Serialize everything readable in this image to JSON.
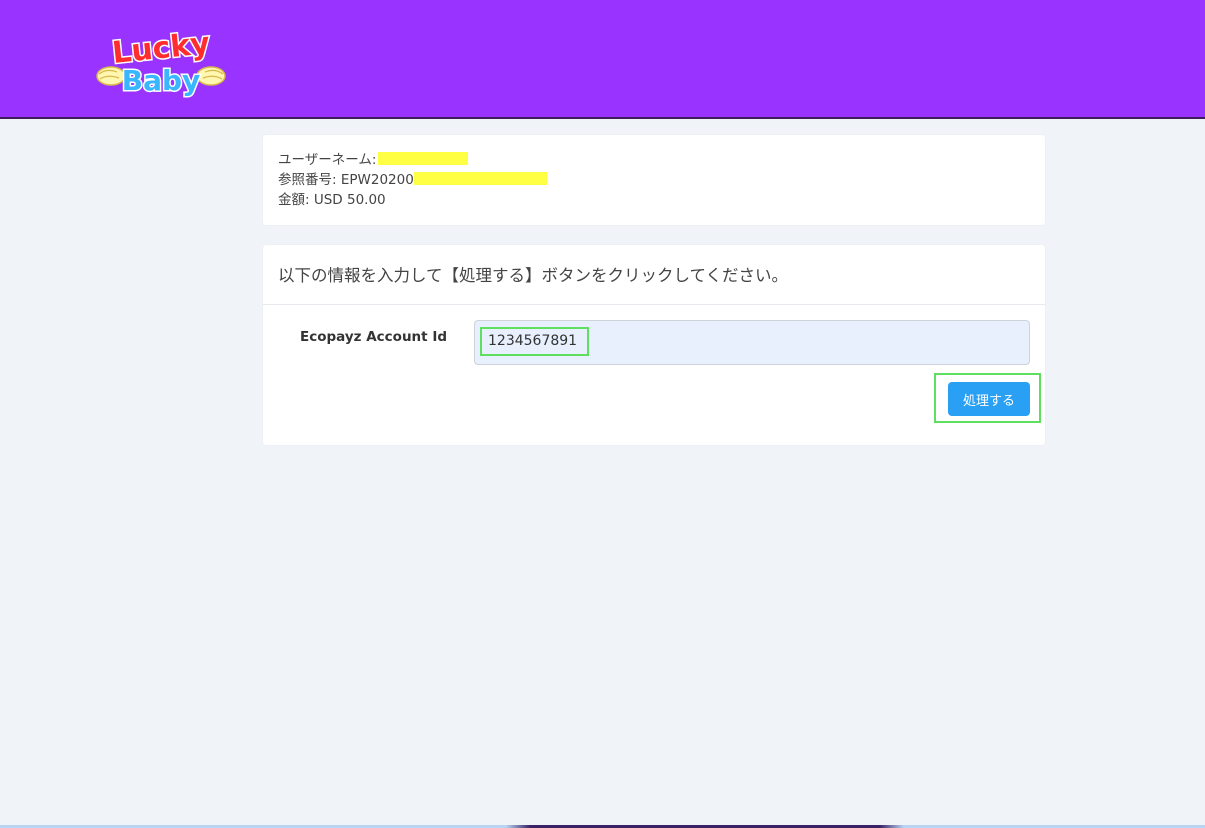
{
  "header": {
    "brand_color": "#9933ff",
    "logo": {
      "line1": "Lucky",
      "line2": "Baby"
    }
  },
  "summary": {
    "username_label": "ユーザーネーム:",
    "reference_label": "参照番号: EPW20200",
    "amount_label": "金額: USD 50.00"
  },
  "form": {
    "instruction": "以下の情報を入力して【処理する】ボタンをクリックしてください。",
    "account_label": "Ecopayz Account Id",
    "account_value": "1234567891",
    "submit_label": "処理する",
    "accent_color": "#2aa0f4",
    "highlight_color": "#5ee05e"
  }
}
